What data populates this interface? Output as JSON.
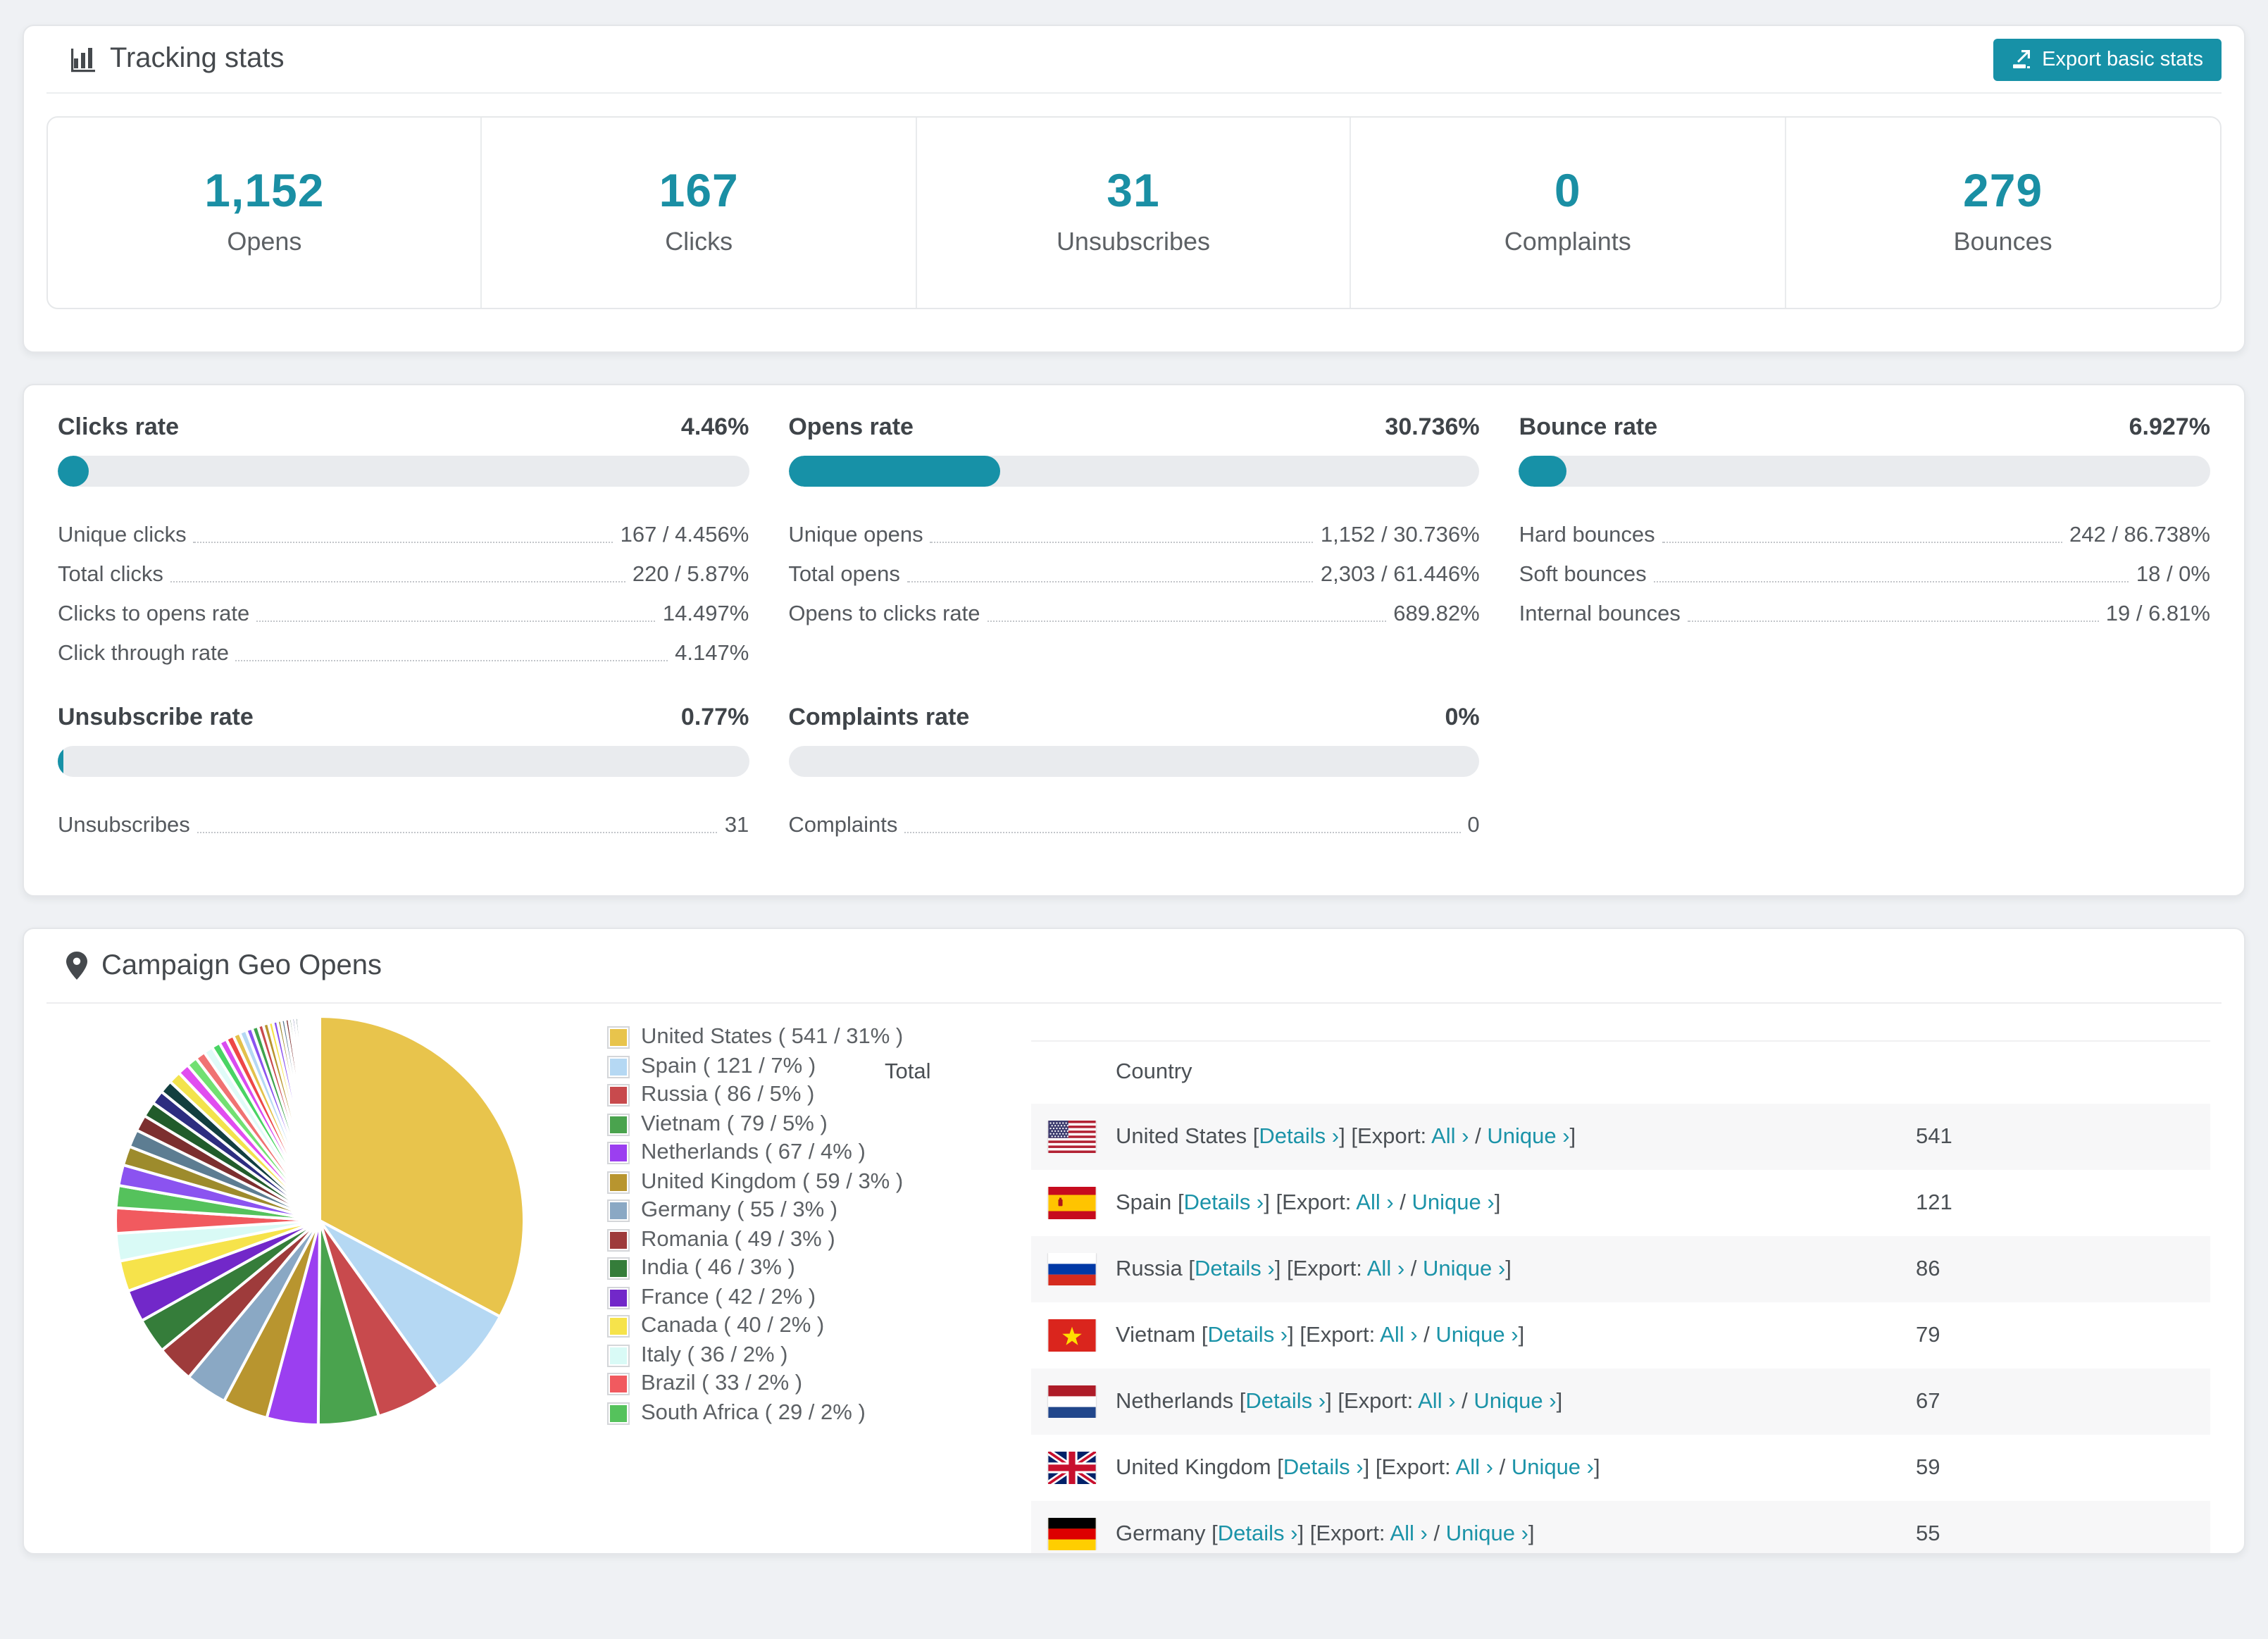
{
  "page": {
    "background": "#eff1f4",
    "accent": "#1791a7"
  },
  "header": {
    "title": "Tracking stats",
    "export_label": "Export basic stats"
  },
  "stats": [
    {
      "value": "1,152",
      "label": "Opens"
    },
    {
      "value": "167",
      "label": "Clicks"
    },
    {
      "value": "31",
      "label": "Unsubscribes"
    },
    {
      "value": "0",
      "label": "Complaints"
    },
    {
      "value": "279",
      "label": "Bounces"
    }
  ],
  "rates": [
    {
      "title": "Clicks rate",
      "percent": "4.46%",
      "fill": 4.46,
      "rows": [
        {
          "label": "Unique clicks",
          "value": "167 / 4.456%"
        },
        {
          "label": "Total clicks",
          "value": "220 / 5.87%"
        },
        {
          "label": "Clicks to opens rate",
          "value": "14.497%"
        },
        {
          "label": "Click through rate",
          "value": "4.147%"
        }
      ]
    },
    {
      "title": "Opens rate",
      "percent": "30.736%",
      "fill": 30.736,
      "rows": [
        {
          "label": "Unique opens",
          "value": "1,152 / 30.736%"
        },
        {
          "label": "Total opens",
          "value": "2,303 / 61.446%"
        },
        {
          "label": "Opens to clicks rate",
          "value": "689.82%"
        }
      ]
    },
    {
      "title": "Bounce rate",
      "percent": "6.927%",
      "fill": 6.927,
      "rows": [
        {
          "label": "Hard bounces",
          "value": "242 / 86.738%"
        },
        {
          "label": "Soft bounces",
          "value": "18 / 0%"
        },
        {
          "label": "Internal bounces",
          "value": "19 / 6.81%"
        }
      ]
    },
    {
      "title": "Unsubscribe rate",
      "percent": "0.77%",
      "fill": 0.77,
      "rows": [
        {
          "label": "Unsubscribes",
          "value": "31"
        }
      ]
    },
    {
      "title": "Complaints rate",
      "percent": "0%",
      "fill": 0,
      "rows": [
        {
          "label": "Complaints",
          "value": "0"
        }
      ]
    }
  ],
  "geo": {
    "title": "Campaign Geo Opens",
    "table": {
      "country_header": "Country",
      "total_header": "Total"
    },
    "link_labels": {
      "details": "Details",
      "export_prefix": "[Export:",
      "all": "All",
      "unique": "Unique",
      "chevron": "›",
      "open_bracket": "[",
      "close_bracket": "]",
      "slash": "/"
    },
    "rows": [
      {
        "country": "United States",
        "flag": "us",
        "total": "541"
      },
      {
        "country": "Spain",
        "flag": "es",
        "total": "121"
      },
      {
        "country": "Russia",
        "flag": "ru",
        "total": "86"
      },
      {
        "country": "Vietnam",
        "flag": "vn",
        "total": "79"
      },
      {
        "country": "Netherlands",
        "flag": "nl",
        "total": "67"
      },
      {
        "country": "United Kingdom",
        "flag": "gb",
        "total": "59"
      },
      {
        "country": "Germany",
        "flag": "de",
        "total": "55"
      }
    ]
  },
  "chart_data": {
    "type": "pie",
    "title": "Campaign Geo Opens",
    "legend_position": "right",
    "start_angle_deg": -90,
    "direction": "clockwise",
    "series": [
      {
        "name": "United States",
        "value": 541,
        "pct": "31%",
        "color": "#e8c44c"
      },
      {
        "name": "Spain",
        "value": 121,
        "pct": "7%",
        "color": "#b5d8f3"
      },
      {
        "name": "Russia",
        "value": 86,
        "pct": "5%",
        "color": "#c84a4d"
      },
      {
        "name": "Vietnam",
        "value": 79,
        "pct": "5%",
        "color": "#4aa34e"
      },
      {
        "name": "Netherlands",
        "value": 67,
        "pct": "4%",
        "color": "#9b3ff0"
      },
      {
        "name": "United Kingdom",
        "value": 59,
        "pct": "3%",
        "color": "#b8952f"
      },
      {
        "name": "Germany",
        "value": 55,
        "pct": "3%",
        "color": "#8aa8c4"
      },
      {
        "name": "Romania",
        "value": 49,
        "pct": "3%",
        "color": "#9e3b3b"
      },
      {
        "name": "India",
        "value": 46,
        "pct": "3%",
        "color": "#357d3a"
      },
      {
        "name": "France",
        "value": 42,
        "pct": "2%",
        "color": "#7228c9"
      },
      {
        "name": "Canada",
        "value": 40,
        "pct": "2%",
        "color": "#f6e34b"
      },
      {
        "name": "Italy",
        "value": 36,
        "pct": "2%",
        "color": "#d9faf6"
      },
      {
        "name": "Brazil",
        "value": 33,
        "pct": "2%",
        "color": "#f15a5f"
      },
      {
        "name": "South Africa",
        "value": 29,
        "pct": "2%",
        "color": "#55c25c"
      }
    ],
    "others": {
      "values": [
        27,
        25,
        23,
        21,
        20,
        18,
        17,
        16,
        15,
        14,
        13,
        12,
        11,
        10,
        10,
        9,
        9,
        8,
        8,
        7,
        7,
        6,
        6,
        5,
        5,
        5,
        4,
        4,
        4,
        3,
        3,
        3,
        3,
        2,
        2,
        2,
        2,
        2,
        1,
        1,
        1,
        1,
        1,
        1
      ],
      "colors_cycle": [
        "#8b53f0",
        "#9d8b2c",
        "#5d7d92",
        "#7c2f2f",
        "#215c2b",
        "#2d2d80",
        "#123f3f",
        "#f3e34d",
        "#e14df0",
        "#72e072",
        "#f07272",
        "#e0fbf8",
        "#49d464",
        "#d94bf0",
        "#ee4747",
        "#e3c14b",
        "#b5d8f3",
        "#8b53f0",
        "#3fa34d",
        "#c84a4d",
        "#b8952f",
        "#f6e34b"
      ]
    }
  }
}
